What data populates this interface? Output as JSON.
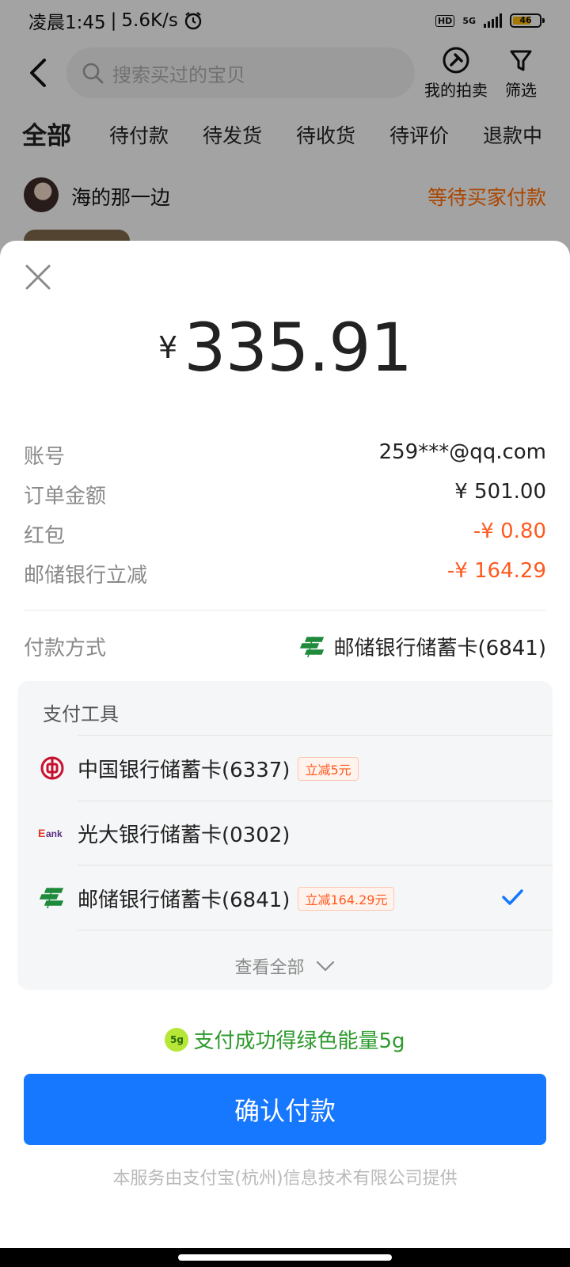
{
  "status_bar": {
    "time": "凌晨1:45",
    "separator": "|",
    "speed": "5.6K/s",
    "alarm_icon": "alarm-clock-icon",
    "hd": "HD",
    "network": "5G",
    "battery": "46",
    "battery_color": "#f5b400"
  },
  "background_page": {
    "search_placeholder": "搜索买过的宝贝",
    "actions": {
      "auction": "我的拍卖",
      "filter": "筛选"
    },
    "tabs": [
      "全部",
      "待付款",
      "待发货",
      "待收货",
      "待评价",
      "退款中"
    ],
    "active_tab": "全部",
    "seller": {
      "name": "海的那一边",
      "status": "等待买家付款"
    }
  },
  "payment_sheet": {
    "currency_symbol": "¥",
    "amount": "335.91",
    "details": [
      {
        "label": "账号",
        "value": "259***@qq.com",
        "highlight": false
      },
      {
        "label": "订单金额",
        "value": "¥ 501.00",
        "highlight": false
      },
      {
        "label": "红包",
        "value": "-¥ 0.80",
        "highlight": true
      },
      {
        "label": "邮储银行立减",
        "value": "-¥ 164.29",
        "highlight": true
      }
    ],
    "payment_method": {
      "label": "付款方式",
      "value": "邮储银行储蓄卡(6841)",
      "icon": "postal-bank-icon"
    },
    "tool_panel": {
      "title": "支付工具",
      "items": [
        {
          "name": "中国银行储蓄卡(6337)",
          "promo": "立减5元",
          "icon": "bank-of-china-icon",
          "selected": false
        },
        {
          "name": "光大银行储蓄卡(0302)",
          "promo": "",
          "icon": "ebank-icon",
          "selected": false
        },
        {
          "name": "邮储银行储蓄卡(6841)",
          "promo": "立减164.29元",
          "icon": "postal-bank-icon",
          "selected": true
        }
      ],
      "view_all": "查看全部"
    },
    "energy_badge": "5g",
    "energy_text": "支付成功得绿色能量5g",
    "confirm_label": "确认付款",
    "footer_note": "本服务由支付宝(杭州)信息技术有限公司提供",
    "colors": {
      "primary": "#1677ff",
      "discount": "#ff5a1f",
      "energy": "#2e9b2e",
      "status": "#ff6a00"
    }
  }
}
